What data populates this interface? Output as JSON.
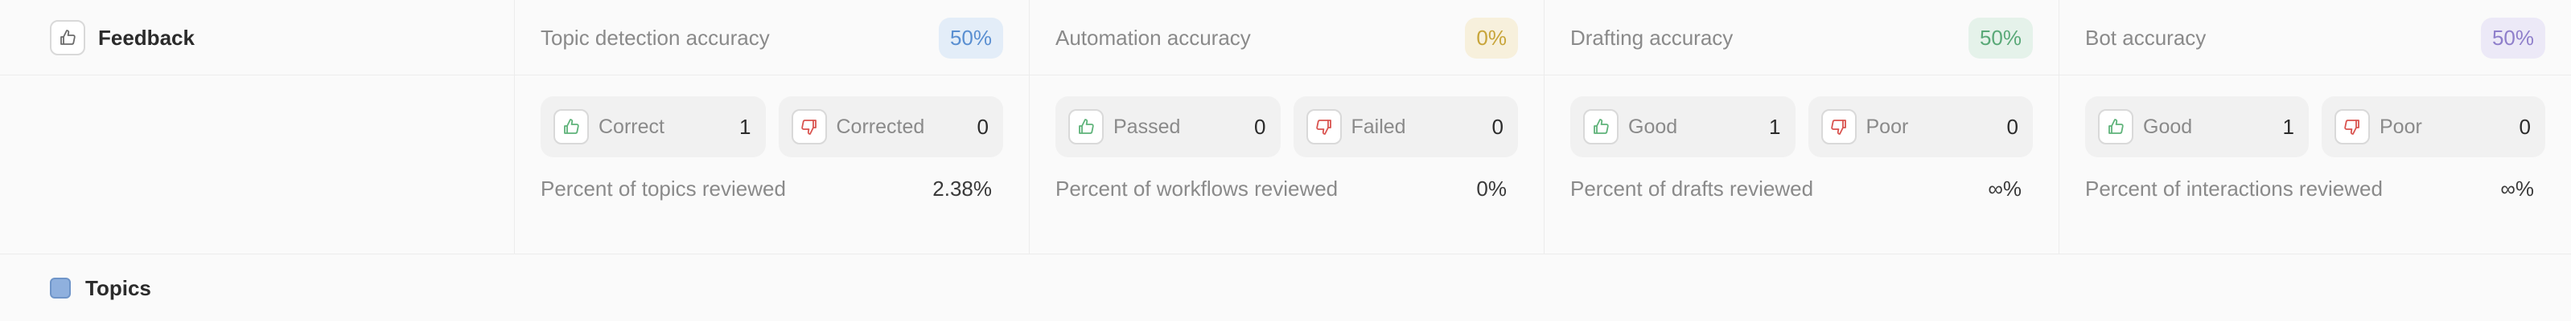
{
  "header": {
    "feedback_label": "Feedback",
    "feedback_icon": "thumbs-up-icon"
  },
  "metrics": [
    {
      "title": "Topic detection accuracy",
      "badge": "50%",
      "badge_color": "#5a8fd1",
      "positive": {
        "label": "Correct",
        "count": "1"
      },
      "negative": {
        "label": "Corrected",
        "count": "0"
      },
      "percent_label": "Percent of topics reviewed",
      "percent_value": "2.38%"
    },
    {
      "title": "Automation accuracy",
      "badge": "0%",
      "badge_color": "#c8a53a",
      "positive": {
        "label": "Passed",
        "count": "0"
      },
      "negative": {
        "label": "Failed",
        "count": "0"
      },
      "percent_label": "Percent of workflows reviewed",
      "percent_value": "0%"
    },
    {
      "title": "Drafting accuracy",
      "badge": "50%",
      "badge_color": "#5aa978",
      "positive": {
        "label": "Good",
        "count": "1"
      },
      "negative": {
        "label": "Poor",
        "count": "0"
      },
      "percent_label": "Percent of drafts reviewed",
      "percent_value": "∞%"
    },
    {
      "title": "Bot accuracy",
      "badge": "50%",
      "badge_color": "#8f7fcb",
      "positive": {
        "label": "Good",
        "count": "1"
      },
      "negative": {
        "label": "Poor",
        "count": "0"
      },
      "percent_label": "Percent of interactions reviewed",
      "percent_value": "∞%"
    }
  ],
  "topics": {
    "label": "Topics",
    "swatch_color": "#8fb0de"
  },
  "colors": {
    "thumbs_up": "#5fb37a",
    "thumbs_down": "#d9534f"
  }
}
